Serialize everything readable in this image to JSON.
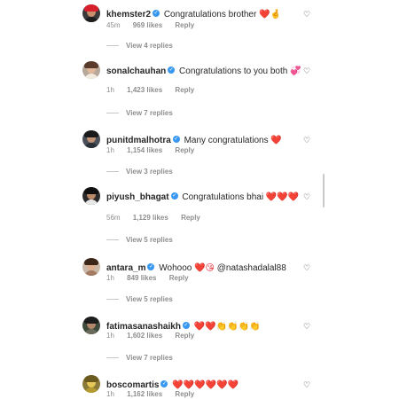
{
  "comments": [
    {
      "username": "khemster2",
      "text": "Congratulations brother",
      "emoji": "❤️🤞",
      "time": "45m",
      "likes": "969 likes",
      "reply": "Reply",
      "view_replies": "View 4 replies",
      "avatar": {
        "bg": "#3a3a3a",
        "face": "#c98f6c",
        "hair": "#d8202c",
        "body": "#1d1d1d"
      }
    },
    {
      "username": "sonalchauhan",
      "text": "Congratulations to you both",
      "emoji": "💞",
      "time": "1h",
      "likes": "1,423 likes",
      "reply": "Reply",
      "view_replies": "View 7 replies",
      "avatar": {
        "bg": "#b7a89a",
        "face": "#e0b79a",
        "hair": "#5a3a2a",
        "body": "#f2ecdf"
      }
    },
    {
      "username": "punitdmalhotra",
      "text": "Many congratulations",
      "emoji": "❤️",
      "time": "1h",
      "likes": "1,154 likes",
      "reply": "Reply",
      "view_replies": "View 3 replies",
      "avatar": {
        "bg": "#4a5058",
        "face": "#c09376",
        "hair": "#1a1a1a",
        "body": "#2a3038"
      }
    },
    {
      "username": "piyush_bhagat",
      "text": "Congratulations bhai",
      "emoji": "❤️❤️❤️",
      "time": "56m",
      "likes": "1,129 likes",
      "reply": "Reply",
      "view_replies": "View 5 replies",
      "avatar": {
        "bg": "#2c2c2c",
        "face": "#b98a6a",
        "hair": "#101010",
        "body": "#e8e8e8"
      }
    },
    {
      "username": "antara_m",
      "text": "Wohooo",
      "emoji": "❤️😘",
      "mention": "@natashadalal88",
      "time": "1h",
      "likes": "849 likes",
      "reply": "Reply",
      "view_replies": "View 5 replies",
      "avatar": {
        "bg": "#c9b8a8",
        "face": "#dcae90",
        "hair": "#3b2418",
        "body": "#a37a62"
      }
    },
    {
      "username": "fatimasanashaikh",
      "text": "",
      "emoji": "❤️❤️👏👏👏👏",
      "time": "1h",
      "likes": "1,602 likes",
      "reply": "Reply",
      "view_replies": "View 7 replies",
      "avatar": {
        "bg": "#3e4a3c",
        "face": "#b3876a",
        "hair": "#1c1c1c",
        "body": "#6a6a5a"
      }
    },
    {
      "username": "boscomartis",
      "text": "",
      "emoji": "❤️❤️❤️❤️❤️❤️",
      "time": "1h",
      "likes": "1,162 likes",
      "reply": "Reply",
      "view_replies": "",
      "avatar": {
        "bg": "#8a7a3a",
        "face": "#e6c75a",
        "hair": "#6a5a20",
        "body": "#b59a30"
      }
    }
  ],
  "icons": {
    "like": "heart-outline-icon",
    "verified": "verified-badge-icon"
  },
  "colors": {
    "heart": "#e2303a",
    "verified": "#3897f0",
    "muted": "#8e8e8e",
    "text": "#262626"
  }
}
